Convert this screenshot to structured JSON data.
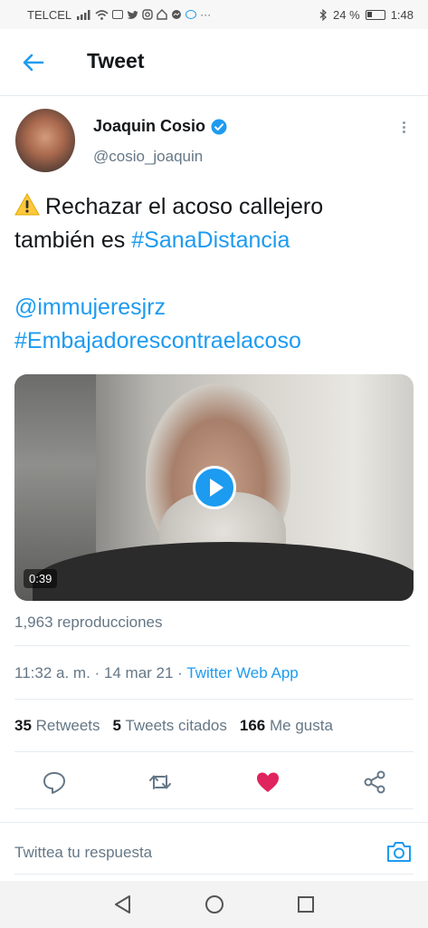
{
  "status_bar": {
    "carrier": "TELCEL",
    "battery": "24 %",
    "time": "1:48"
  },
  "header": {
    "title": "Tweet"
  },
  "author": {
    "name": "Joaquin Cosio",
    "handle": "@cosio_joaquin"
  },
  "tweet": {
    "line1": "Rechazar el acoso callejero",
    "line2_prefix": "también es ",
    "hashtag1": "#SanaDistancia",
    "mention": "@immujeresjrz",
    "hashtag2": "#Embajadorescontraelacoso"
  },
  "video": {
    "duration": "0:39"
  },
  "views": "1,963 reproducciones",
  "meta": {
    "time": "11:32 a. m.",
    "date": "14 mar 21",
    "source": "Twitter Web App"
  },
  "stats": {
    "retweets_count": "35",
    "retweets_label": "Retweets",
    "quotes_count": "5",
    "quotes_label": "Tweets citados",
    "likes_count": "166",
    "likes_label": "Me gusta"
  },
  "reply": {
    "placeholder": "Twittea tu respuesta"
  },
  "colors": {
    "accent": "#1d9bf0",
    "like": "#e0245e",
    "muted": "#657786"
  }
}
